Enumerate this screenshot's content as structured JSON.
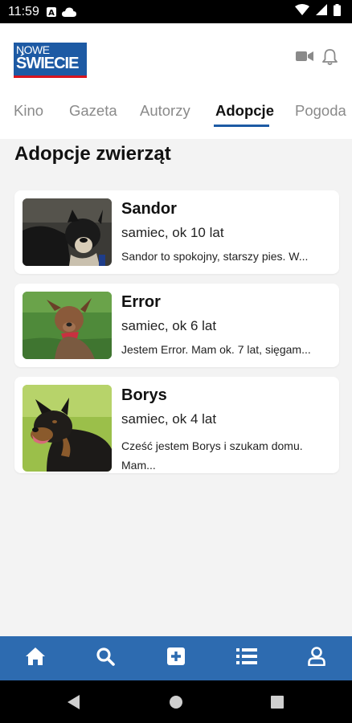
{
  "status_bar": {
    "time": "11:59"
  },
  "header": {
    "logo_line1": "NOWE",
    "logo_line2": "ŚWIECIE",
    "tabs": [
      {
        "label": "Kino"
      },
      {
        "label": "Gazeta"
      },
      {
        "label": "Autorzy"
      },
      {
        "label": "Adopcje"
      },
      {
        "label": "Pogoda"
      }
    ],
    "active_tab": "Adopcje"
  },
  "main": {
    "title": "Adopcje zwierząt",
    "animals": [
      {
        "name": "Sandor",
        "meta": "samiec, ok 10 lat",
        "description": "Sandor to spokojny, starszy pies. W..."
      },
      {
        "name": "Error",
        "meta": "samiec, ok 6 lat",
        "description": "Jestem Error. Mam ok. 7 lat, sięgam..."
      },
      {
        "name": "Borys",
        "meta": "samiec, ok 4 lat",
        "description_line1": "Cześć jestem Borys i szukam domu.",
        "description_line2": "Mam..."
      }
    ]
  },
  "bottom_nav": {
    "items": [
      "home-icon",
      "search-icon",
      "add-icon",
      "list-icon",
      "profile-icon"
    ]
  },
  "colors": {
    "brand_blue": "#2d6bb0",
    "logo_red": "#d8141e"
  }
}
